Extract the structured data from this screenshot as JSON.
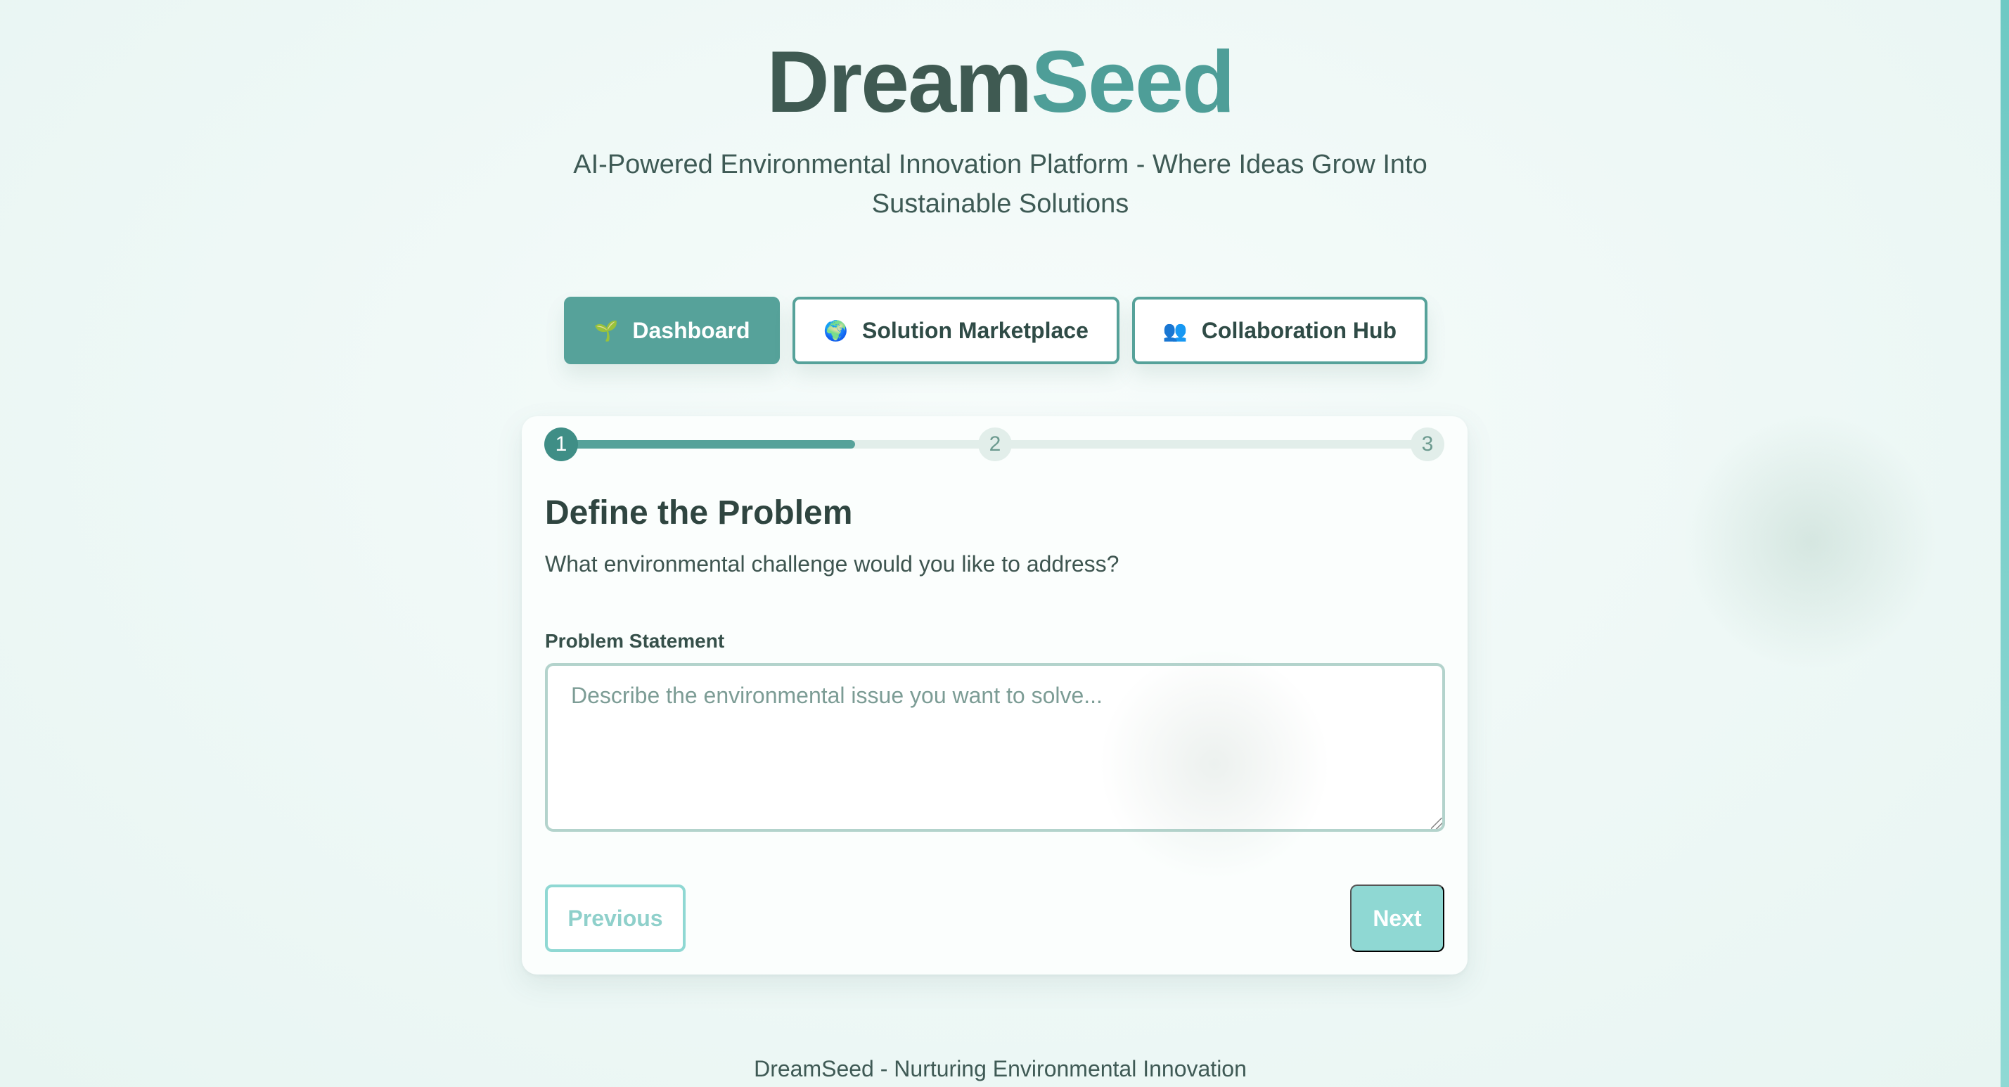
{
  "brand": {
    "part1": "Dream",
    "part2": "Seed"
  },
  "tagline": "AI-Powered Environmental Innovation Platform - Where Ideas Grow Into Sustainable Solutions",
  "nav": [
    {
      "icon": "🌱",
      "label": "Dashboard",
      "active": true
    },
    {
      "icon": "🌍",
      "label": "Solution Marketplace",
      "active": false
    },
    {
      "icon": "👥",
      "label": "Collaboration Hub",
      "active": false
    }
  ],
  "wizard": {
    "steps": [
      "1",
      "2",
      "3"
    ],
    "current_step": 1,
    "progress_fraction": 0.34,
    "title": "Define the Problem",
    "subtitle": "What environmental challenge would you like to address?",
    "field_label": "Problem Statement",
    "field_placeholder": "Describe the environmental issue you want to solve...",
    "field_value": "",
    "prev_label": "Previous",
    "next_label": "Next"
  },
  "footer": "DreamSeed - Nurturing Environmental Innovation",
  "colors": {
    "primary": "#56a29a",
    "brand_dark": "#3f5a52",
    "brand_accent": "#4e9e98",
    "disabled": "#8fd8d3"
  }
}
